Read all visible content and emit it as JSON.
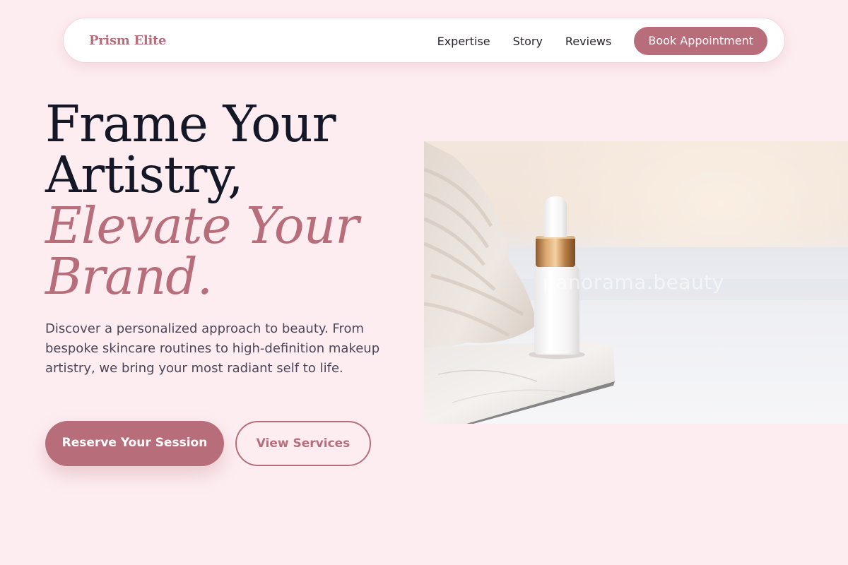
{
  "nav": {
    "brand": "Prism Elite",
    "links": [
      "Expertise",
      "Story",
      "Reviews"
    ],
    "cta_label": "Book Appointment"
  },
  "hero": {
    "title_line1": "Frame Your",
    "title_line2": "Artistry,",
    "title_line3": "Elevate Your",
    "title_line4": "Brand.",
    "description": "Discover a personalized approach to beauty. From bespoke skincare routines to high-definition makeup artistry, we bring your most radiant self to life.",
    "primary_button": "Reserve Your Session",
    "secondary_button": "View Services",
    "image_watermark": "panorama.beauty"
  },
  "colors": {
    "background": "#fdedf1",
    "accent": "#b86e7a",
    "heading": "#141726",
    "body_text": "#4b4658"
  }
}
